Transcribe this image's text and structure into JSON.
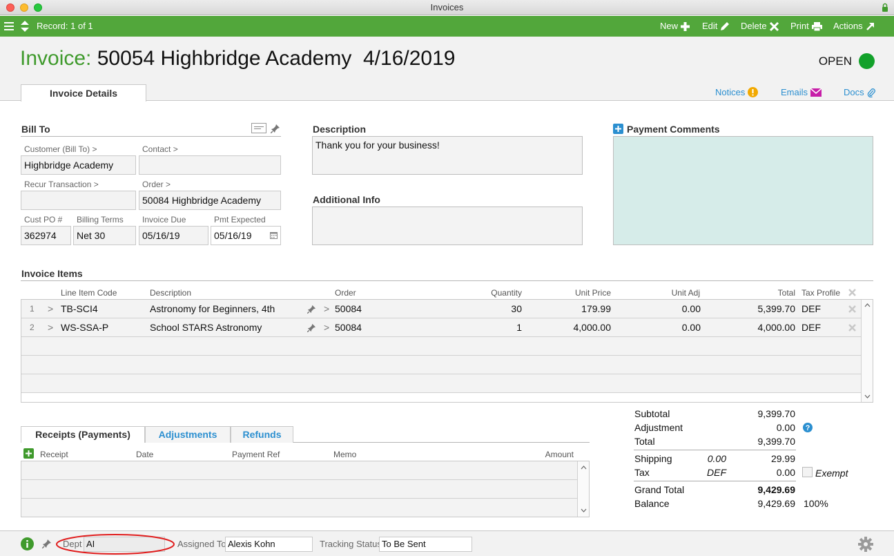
{
  "window": {
    "title": "Invoices"
  },
  "toolbar": {
    "record": "Record: 1 of 1",
    "new": "New",
    "edit": "Edit",
    "delete": "Delete",
    "print": "Print",
    "actions": "Actions"
  },
  "header": {
    "label": "Invoice:",
    "title": "50054 Highbridge Academy  4/16/2019",
    "status": "OPEN",
    "status_color": "#12a12a",
    "tab": "Invoice Details",
    "links": {
      "notices": "Notices",
      "emails": "Emails",
      "docs": "Docs"
    }
  },
  "bill_to": {
    "title": "Bill To",
    "customer_label": "Customer (Bill To) >",
    "customer": "Highbridge Academy",
    "contact_label": "Contact >",
    "contact": "",
    "recur_label": "Recur Transaction >",
    "recur": "",
    "order_label": "Order >",
    "order": "50084 Highbridge Academy",
    "cust_po_label": "Cust PO #",
    "cust_po": "362974",
    "billing_terms_label": "Billing Terms",
    "billing_terms": "Net 30",
    "invoice_due_label": "Invoice Due",
    "invoice_due": "05/16/19",
    "pmt_expected_label": "Pmt Expected",
    "pmt_expected": "05/16/19"
  },
  "description": {
    "title": "Description",
    "text": "Thank you for your business!"
  },
  "additional_info": {
    "title": "Additional Info",
    "text": ""
  },
  "payment_comments": {
    "title": "Payment Comments",
    "text": ""
  },
  "items": {
    "title": "Invoice Items",
    "headers": {
      "code": "Line Item Code",
      "description": "Description",
      "order": "Order",
      "quantity": "Quantity",
      "unit_price": "Unit Price",
      "unit_adj": "Unit Adj",
      "total": "Total",
      "tax_profile": "Tax Profile"
    },
    "rows": [
      {
        "num": "1",
        "code": "TB-SCI4",
        "description": "Astronomy for Beginners, 4th",
        "order": "50084",
        "quantity": "30",
        "unit_price": "179.99",
        "unit_adj": "0.00",
        "total": "5,399.70",
        "tax": "DEF"
      },
      {
        "num": "2",
        "code": "WS-SSA-P",
        "description": "School STARS Astronomy",
        "order": "50084",
        "quantity": "1",
        "unit_price": "4,000.00",
        "unit_adj": "0.00",
        "total": "4,000.00",
        "tax": "DEF"
      }
    ]
  },
  "receipts": {
    "tabs": [
      "Receipts (Payments)",
      "Adjustments",
      "Refunds"
    ],
    "headers": {
      "receipt": "Receipt",
      "date": "Date",
      "payment_ref": "Payment Ref",
      "memo": "Memo",
      "amount": "Amount"
    }
  },
  "totals": {
    "subtotal_label": "Subtotal",
    "subtotal": "9,399.70",
    "adjustment_label": "Adjustment",
    "adjustment": "0.00",
    "total_label": "Total",
    "total": "9,399.70",
    "shipping_label": "Shipping",
    "shipping_rate": "0.00",
    "shipping": "29.99",
    "tax_label": "Tax",
    "tax_profile": "DEF",
    "tax": "0.00",
    "exempt_label": "Exempt",
    "grand_total_label": "Grand Total",
    "grand_total": "9,429.69",
    "balance_label": "Balance",
    "balance": "9,429.69",
    "balance_pct": "100%"
  },
  "footer": {
    "dept_label": "Dept",
    "dept": "AI",
    "assigned_label": "Assigned To",
    "assigned": "Alexis Kohn",
    "tracking_label": "Tracking Status",
    "tracking": "To Be Sent"
  }
}
